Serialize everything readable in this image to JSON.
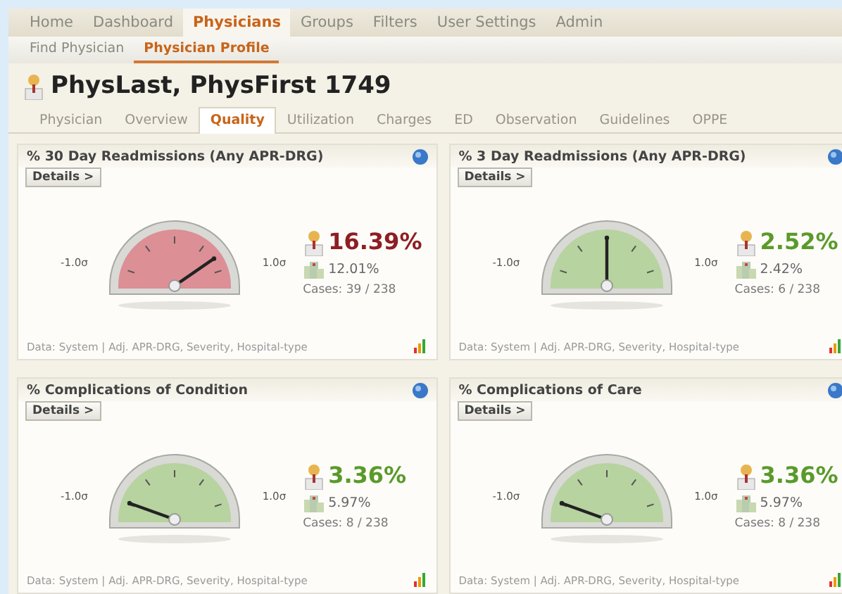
{
  "main_nav": [
    {
      "label": "Home",
      "selected": false
    },
    {
      "label": "Dashboard",
      "selected": false
    },
    {
      "label": "Physicians",
      "selected": true
    },
    {
      "label": "Groups",
      "selected": false
    },
    {
      "label": "Filters",
      "selected": false
    },
    {
      "label": "User Settings",
      "selected": false
    },
    {
      "label": "Admin",
      "selected": false
    }
  ],
  "sub_nav": [
    {
      "label": "Find Physician",
      "selected": false
    },
    {
      "label": "Physician Profile",
      "selected": true
    }
  ],
  "page_title": "PhysLast, PhysFirst 1749",
  "tabs": [
    {
      "label": "Physician",
      "selected": false
    },
    {
      "label": "Overview",
      "selected": false
    },
    {
      "label": "Quality",
      "selected": true
    },
    {
      "label": "Utilization",
      "selected": false
    },
    {
      "label": "Charges",
      "selected": false
    },
    {
      "label": "ED",
      "selected": false
    },
    {
      "label": "Observation",
      "selected": false
    },
    {
      "label": "Guidelines",
      "selected": false
    },
    {
      "label": "OPPE",
      "selected": false
    }
  ],
  "cards": [
    {
      "title": "% 30 Day Readmissions (Any APR-DRG)",
      "details": "Details >",
      "low_label": "-1.0σ",
      "high_label": "1.0σ",
      "level": 0.85,
      "alert": true,
      "physician_value": "16.39%",
      "benchmark_value": "12.01%",
      "cases": "Cases: 39 / 238",
      "footer": "Data: System | Adj. APR-DRG, Severity, Hospital-type"
    },
    {
      "title": "% 3 Day Readmissions (Any APR-DRG)",
      "details": "Details >",
      "low_label": "-1.0σ",
      "high_label": "1.0σ",
      "level": 0.5,
      "alert": false,
      "physician_value": "2.52%",
      "benchmark_value": "2.42%",
      "cases": "Cases: 6 / 238",
      "footer": "Data: System | Adj. APR-DRG, Severity, Hospital-type"
    },
    {
      "title": "% Complications of Condition",
      "details": "Details >",
      "low_label": "-1.0σ",
      "high_label": "1.0σ",
      "level": 0.1,
      "alert": false,
      "physician_value": "3.36%",
      "benchmark_value": "5.97%",
      "cases": "Cases: 8 / 238",
      "footer": "Data: System | Adj. APR-DRG, Severity, Hospital-type"
    },
    {
      "title": "% Complications of Care",
      "details": "Details >",
      "low_label": "-1.0σ",
      "high_label": "1.0σ",
      "level": 0.1,
      "alert": false,
      "physician_value": "3.36%",
      "benchmark_value": "5.97%",
      "cases": "Cases: 8 / 238",
      "footer": "Data: System | Adj. APR-DRG, Severity, Hospital-type"
    }
  ]
}
